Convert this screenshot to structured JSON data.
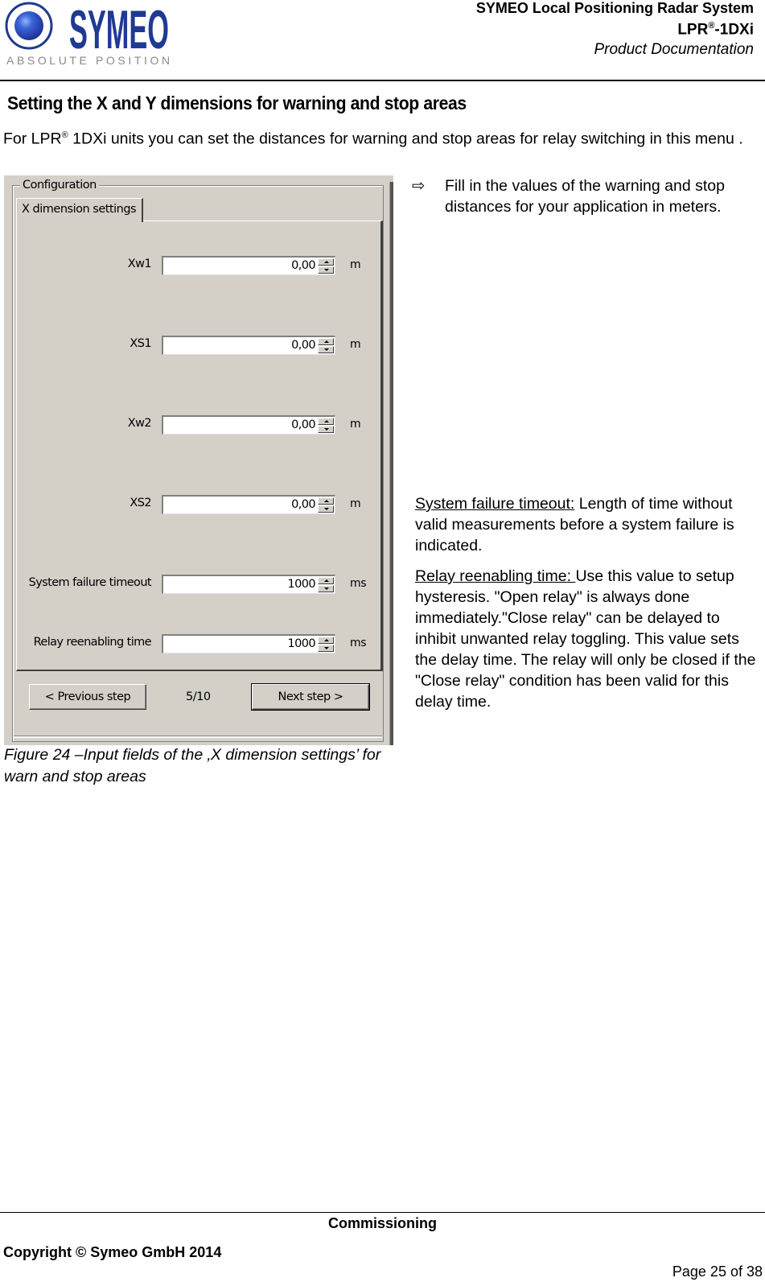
{
  "header": {
    "logo": {
      "wordmark": "SYMEO",
      "tagline": "ABSOLUTE POSITIONING",
      "icon": "symeo-sphere-icon",
      "brand_color": "#1f3a93"
    },
    "title": "SYMEO Local Positioning Radar System",
    "product_prefix": "LPR",
    "product_registered": "®",
    "product_suffix": "-1DXi",
    "doc_type": "Product Documentation"
  },
  "section": {
    "heading": "Setting the X and Y dimensions for warning and stop areas",
    "intro_prefix": "For LPR",
    "intro_registered": "®",
    "intro_rest": " 1DXi units you can set the distances for warning and stop areas for relay switching in this menu ."
  },
  "dialog": {
    "group_label": "Configuration",
    "tab_label": "X dimension settings",
    "fields": [
      {
        "label": "Xw1",
        "value": "0,00",
        "unit": "m"
      },
      {
        "label": "XS1",
        "value": "0,00",
        "unit": "m"
      },
      {
        "label": "Xw2",
        "value": "0,00",
        "unit": "m"
      },
      {
        "label": "XS2",
        "value": "0,00",
        "unit": "m"
      },
      {
        "label": "System failure timeout",
        "value": "1000",
        "unit": "ms"
      },
      {
        "label": "Relay reenabling time",
        "value": "1000",
        "unit": "ms"
      }
    ],
    "prev_button": "< Previous step",
    "step_indicator": "5/10",
    "next_button": "Next step >"
  },
  "instructions": {
    "bullet_icon": "⇨",
    "bullet_text": "Fill in the values of the warning and stop distances for your application in meters.",
    "items": [
      {
        "term": "System failure timeout:",
        "text": " Length of time without valid measurements before a system failure is indicated."
      },
      {
        "term": "Relay reenabling time: ",
        "text": "Use this value to setup hysteresis. \"Open relay\" is always done immediately.\"Close relay\" can be delayed to inhibit unwanted relay toggling. This value sets the delay time. The relay will only be closed if the \"Close relay\" condition has been valid for this delay time."
      }
    ]
  },
  "caption": "Figure 24 –Input fields of the ‚X dimension settings’ for warn and stop areas",
  "footer": {
    "section": "Commissioning",
    "copyright": "Copyright © Symeo GmbH 2014",
    "page": "Page 25 of 38"
  }
}
